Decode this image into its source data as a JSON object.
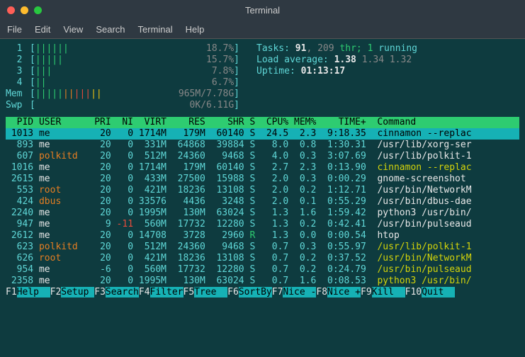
{
  "window": {
    "title": "Terminal"
  },
  "menu": [
    "File",
    "Edit",
    "View",
    "Search",
    "Terminal",
    "Help"
  ],
  "cpus": [
    {
      "label": "1",
      "bars": "||||||",
      "pct": "18.7%"
    },
    {
      "label": "2",
      "bars": "|||||",
      "pct": "15.7%"
    },
    {
      "label": "3",
      "bars": "|||",
      "pct": "7.8%"
    },
    {
      "label": "4",
      "bars": "||",
      "pct": "6.7%"
    }
  ],
  "mem": {
    "label": "Mem",
    "bars": "||||||||||||",
    "used": "965M",
    "total": "7.78G"
  },
  "swp": {
    "label": "Swp",
    "bars": "",
    "used": "0K",
    "total": "6.11G"
  },
  "summary": {
    "tasks_label": "Tasks:",
    "tasks": "91",
    "thr": "209",
    "thr_label": "thr;",
    "running": "1",
    "running_label": "running",
    "load_label": "Load average:",
    "load1": "1.38",
    "load2": "1.34",
    "load3": "1.32",
    "uptime_label": "Uptime:",
    "uptime": "01:13:17"
  },
  "columns": [
    "PID",
    "USER",
    "PRI",
    "NI",
    "VIRT",
    "RES",
    "SHR",
    "S",
    "CPU%",
    "MEM%",
    "TIME+",
    "Command"
  ],
  "rows": [
    {
      "pid": "1013",
      "user": "me",
      "pri": "20",
      "ni": "0",
      "virt": "1714M",
      "res": "179M",
      "shr": "60140",
      "s": "S",
      "cpu": "24.5",
      "mem": "2.3",
      "time": "9:18.35",
      "cmd": "cinnamon --replac",
      "sel": true
    },
    {
      "pid": "893",
      "user": "me",
      "pri": "20",
      "ni": "0",
      "virt": "331M",
      "res": "64868",
      "shr": "39884",
      "s": "S",
      "cpu": "8.0",
      "mem": "0.8",
      "time": "1:30.31",
      "cmd": "/usr/lib/xorg-ser"
    },
    {
      "pid": "607",
      "user": "polkitd",
      "pri": "20",
      "ni": "0",
      "virt": "512M",
      "res": "24360",
      "shr": "9468",
      "s": "S",
      "cpu": "4.0",
      "mem": "0.3",
      "time": "3:07.69",
      "cmd": "/usr/lib/polkit-1"
    },
    {
      "pid": "1016",
      "user": "me",
      "pri": "20",
      "ni": "0",
      "virt": "1714M",
      "res": "179M",
      "shr": "60140",
      "s": "S",
      "cpu": "2.7",
      "mem": "2.3",
      "time": "0:13.90",
      "cmd": "cinnamon --replac",
      "cmdy": true
    },
    {
      "pid": "2615",
      "user": "me",
      "pri": "20",
      "ni": "0",
      "virt": "433M",
      "res": "27500",
      "shr": "15988",
      "s": "S",
      "cpu": "2.0",
      "mem": "0.3",
      "time": "0:00.29",
      "cmd": "gnome-screenshot"
    },
    {
      "pid": "553",
      "user": "root",
      "pri": "20",
      "ni": "0",
      "virt": "421M",
      "res": "18236",
      "shr": "13108",
      "s": "S",
      "cpu": "2.0",
      "mem": "0.2",
      "time": "1:12.71",
      "cmd": "/usr/bin/NetworkM"
    },
    {
      "pid": "424",
      "user": "dbus",
      "pri": "20",
      "ni": "0",
      "virt": "33576",
      "res": "4436",
      "shr": "3248",
      "s": "S",
      "cpu": "2.0",
      "mem": "0.1",
      "time": "0:55.29",
      "cmd": "/usr/bin/dbus-dae"
    },
    {
      "pid": "2240",
      "user": "me",
      "pri": "20",
      "ni": "0",
      "virt": "1995M",
      "res": "130M",
      "shr": "63024",
      "s": "S",
      "cpu": "1.3",
      "mem": "1.6",
      "time": "1:59.42",
      "cmd": "python3 /usr/bin/"
    },
    {
      "pid": "947",
      "user": "me",
      "pri": "9",
      "ni": "-11",
      "virt": "560M",
      "res": "17732",
      "shr": "12280",
      "s": "S",
      "cpu": "1.3",
      "mem": "0.2",
      "time": "0:42.41",
      "cmd": "/usr/bin/pulseaud"
    },
    {
      "pid": "2612",
      "user": "me",
      "pri": "20",
      "ni": "0",
      "virt": "14708",
      "res": "3728",
      "shr": "2960",
      "s": "R",
      "cpu": "1.3",
      "mem": "0.0",
      "time": "0:00.54",
      "cmd": "htop"
    },
    {
      "pid": "623",
      "user": "polkitd",
      "pri": "20",
      "ni": "0",
      "virt": "512M",
      "res": "24360",
      "shr": "9468",
      "s": "S",
      "cpu": "0.7",
      "mem": "0.3",
      "time": "0:55.97",
      "cmd": "/usr/lib/polkit-1",
      "cmdy": true
    },
    {
      "pid": "626",
      "user": "root",
      "pri": "20",
      "ni": "0",
      "virt": "421M",
      "res": "18236",
      "shr": "13108",
      "s": "S",
      "cpu": "0.7",
      "mem": "0.2",
      "time": "0:37.52",
      "cmd": "/usr/bin/NetworkM",
      "cmdy": true
    },
    {
      "pid": "954",
      "user": "me",
      "pri": "-6",
      "ni": "0",
      "virt": "560M",
      "res": "17732",
      "shr": "12280",
      "s": "S",
      "cpu": "0.7",
      "mem": "0.2",
      "time": "0:24.79",
      "cmd": "/usr/bin/pulseaud",
      "cmdy": true
    },
    {
      "pid": "2358",
      "user": "me",
      "pri": "20",
      "ni": "0",
      "virt": "1995M",
      "res": "130M",
      "shr": "63024",
      "s": "S",
      "cpu": "0.7",
      "mem": "1.6",
      "time": "0:08.53",
      "cmd": "python3 /usr/bin/",
      "cmdy": true
    }
  ],
  "fkeys": [
    {
      "k": "F1",
      "l": "Help"
    },
    {
      "k": "F2",
      "l": "Setup"
    },
    {
      "k": "F3",
      "l": "Search"
    },
    {
      "k": "F4",
      "l": "Filter"
    },
    {
      "k": "F5",
      "l": "Tree"
    },
    {
      "k": "F6",
      "l": "SortBy"
    },
    {
      "k": "F7",
      "l": "Nice -"
    },
    {
      "k": "F8",
      "l": "Nice +"
    },
    {
      "k": "F9",
      "l": "Kill"
    },
    {
      "k": "F10",
      "l": "Quit"
    }
  ]
}
